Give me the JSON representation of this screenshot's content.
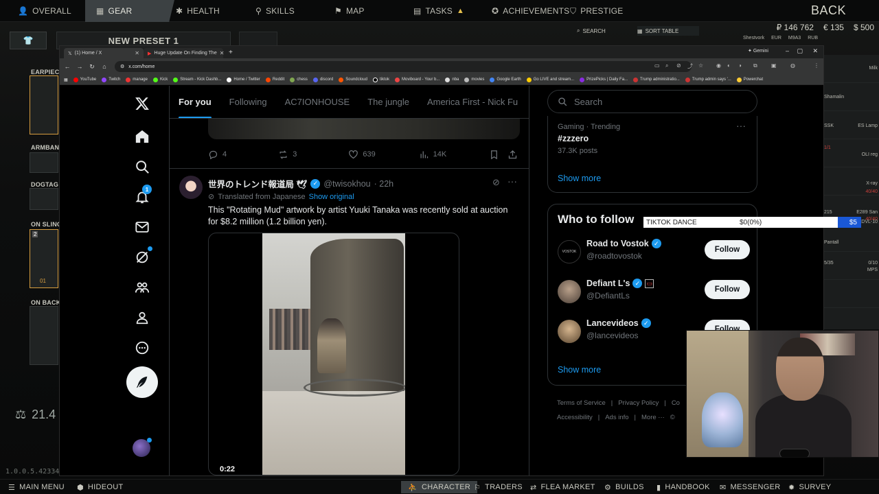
{
  "game": {
    "tabs": [
      {
        "label": "OVERALL",
        "icon": "person-icon"
      },
      {
        "label": "GEAR",
        "icon": "gear-grid-icon"
      },
      {
        "label": "HEALTH",
        "icon": "health-icon"
      },
      {
        "label": "SKILLS",
        "icon": "skills-icon"
      },
      {
        "label": "MAP",
        "icon": "map-pin-icon"
      },
      {
        "label": "TASKS",
        "icon": "tasks-icon"
      },
      {
        "label": "ACHIEVEMENTS",
        "icon": "achievements-icon"
      },
      {
        "label": "PRESTIGE",
        "icon": "prestige-icon"
      }
    ],
    "back_label": "BACK",
    "money": {
      "rubles": "₽ 146 762",
      "euros": "€ 135",
      "dollars": "$ 500"
    },
    "preset_name": "NEW PRESET 1",
    "slots": {
      "earpiece": "EARPIECE",
      "armband": "ARMBAND",
      "dogtag": "DOGTAG",
      "sling": "ON SLING",
      "back": "ON BACK"
    },
    "sling_count": "2",
    "sling_level": "01",
    "weight": "21.4",
    "version": "1.0.0.5.42334",
    "search_label": "SEARCH",
    "sort_label": "SORT TABLE",
    "traders": [
      "Shestvork",
      "EUR",
      "M9A3",
      "RUB"
    ],
    "right_items": [
      "Milk",
      "Shamalin",
      "SSK",
      "ES Lamp",
      "1/1",
      "OLI reg",
      "X-ray",
      "40/40",
      "215",
      "E289 San",
      "40/40",
      "DVL-10",
      "Pantall",
      "5/35",
      "0/10",
      "MPS"
    ],
    "bottom": [
      "MAIN MENU",
      "HIDEOUT",
      "CHARACTER",
      "TRADERS",
      "FLEA MARKET",
      "BUILDS",
      "HANDBOOK",
      "MESSENGER",
      "SURVEY"
    ]
  },
  "browser": {
    "tabs": [
      {
        "title": "(1) Home / X"
      },
      {
        "title": "Huge Update On Finding The"
      }
    ],
    "gemini_label": "Gemini",
    "url": "x.com/home",
    "bookmarks": [
      "YouTube",
      "Twitch",
      "manage",
      "Kick",
      "Stream - Kick Dashb...",
      "Home / Twitter",
      "Reddit",
      "chess",
      "discord",
      "Soundcloud",
      "tiktok",
      "Moviboard - Your b...",
      "nba",
      "movies",
      "Google Earth",
      "Go LIVE and stream...",
      "PrizePicks | Daily Fa...",
      "Trump administratio...",
      "Trump admin says '...",
      "Powerchat"
    ]
  },
  "x": {
    "notification_count": "1",
    "feed_tabs": [
      "For you",
      "Following",
      "AC7IONHOUSE",
      "The jungle",
      "America First - Nick Fu"
    ],
    "prev_post": {
      "replies": "4",
      "reposts": "3",
      "likes": "639",
      "views": "14K"
    },
    "tweet": {
      "name": "世界のトレンド報道局 🕊",
      "handle": "@twisokhou",
      "time": "· 22h",
      "translated": "Translated from Japanese",
      "show_original": "Show original",
      "text": "This \"Rotating Mud\" artwork by artist Yuuki Tanaka was recently sold at auction for $8.2 million (1.2 billion yen).",
      "video_time": "0:22"
    },
    "search_placeholder": "Search",
    "trend": {
      "category": "Gaming · Trending",
      "name": "#zzzero",
      "posts": "37.3K posts",
      "show_more": "Show more"
    },
    "who_to_follow": {
      "title": "Who to follow",
      "users": [
        {
          "name": "Road to Vostok",
          "handle": "@roadtovostok",
          "button": "Follow"
        },
        {
          "name": "Defiant L's",
          "handle": "@DefiantLs",
          "button": "Follow"
        },
        {
          "name": "Lancevideos",
          "handle": "@lancevideos",
          "button": "Follow"
        }
      ],
      "show_more": "Show more"
    },
    "footer": [
      "Terms of Service",
      "|",
      "Privacy Policy",
      "|",
      "Co",
      "Accessibility",
      "|",
      "Ads info",
      "|",
      "More ···",
      "©"
    ]
  },
  "overlay": {
    "tiktok_label": "TIKTOK DANCE",
    "tiktok_progress": "$0(0%)",
    "tiktok_goal": "$5"
  },
  "colors": {
    "x_blue": "#1d9bf0",
    "game_accent": "#d89e40",
    "tarkov_tab_active": "#3c4143"
  }
}
